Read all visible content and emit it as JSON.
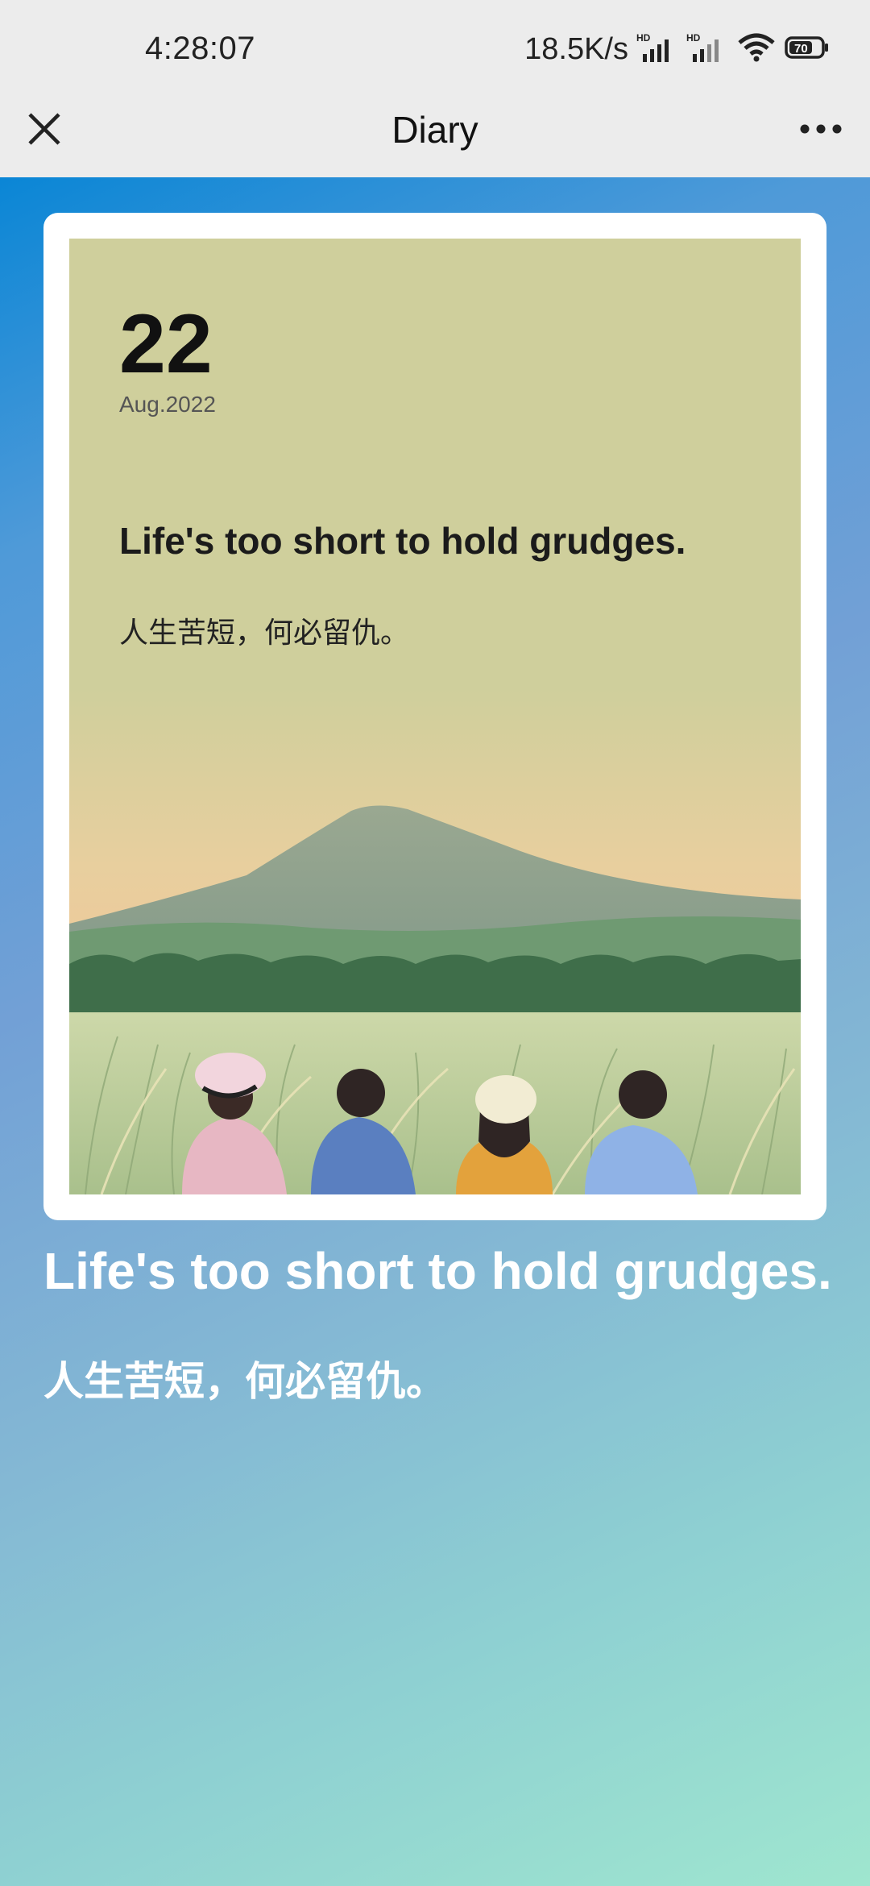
{
  "status_bar": {
    "time": "4:28:07",
    "net_speed": "18.5K/s",
    "signal1_icon": "signal-hd-icon",
    "signal2_icon": "signal-hd-icon",
    "wifi_icon": "wifi-icon",
    "battery_icon": "battery-icon",
    "battery_level": "70"
  },
  "nav": {
    "title": "Diary",
    "close_icon": "close-icon",
    "more_icon": "more-icon"
  },
  "card": {
    "day": "22",
    "month": "Aug.2022",
    "quote_en": "Life's too short to hold grudges.",
    "quote_zh": "人生苦短，何必留仇。"
  },
  "caption": {
    "quote_en": "Life's too short to hold grudges.",
    "quote_zh": "人生苦短，何必留仇。"
  },
  "colors": {
    "card_background": "#cfcf9c",
    "gradient_start": "#0a86d6",
    "gradient_end": "#9fe6cf"
  }
}
